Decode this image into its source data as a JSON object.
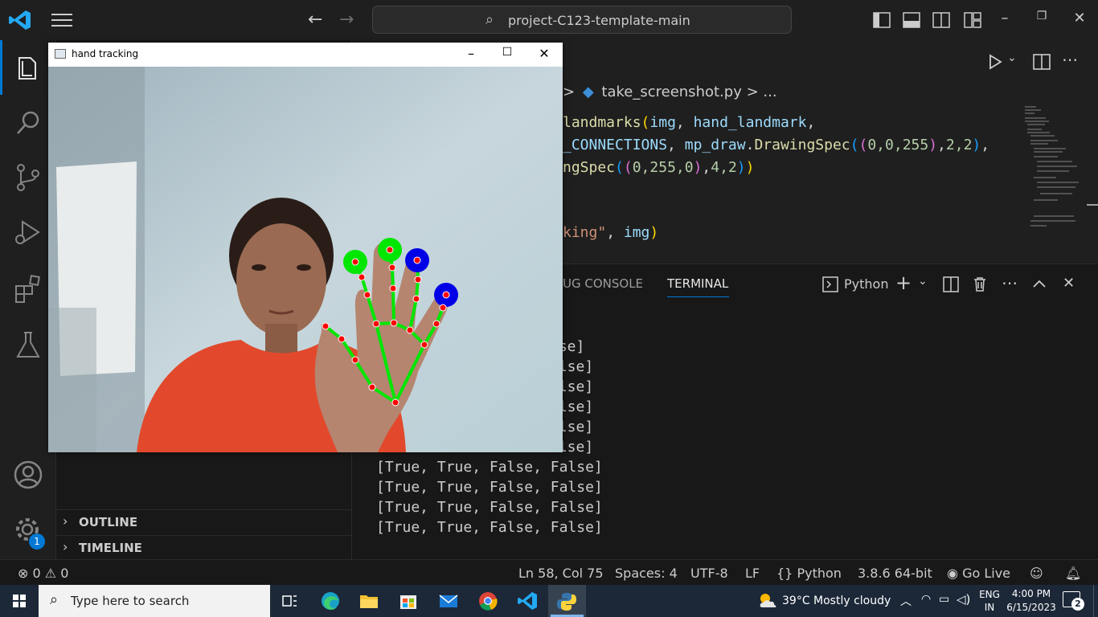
{
  "titlebar": {
    "search_text": "project-C123-template-main"
  },
  "activity": {
    "settings_badge": "1"
  },
  "sidebar": {
    "sections": [
      {
        "label": "OUTLINE"
      },
      {
        "label": "TIMELINE"
      }
    ]
  },
  "editor": {
    "breadcrumb_file": "take_screenshot.py",
    "breadcrumb_sep": ">",
    "breadcrumb_more": "...",
    "lines": [
      {
        "a": "landmarks",
        "b": "img",
        "c": "hand_landmark"
      },
      {
        "a": "_CONNECTIONS",
        "b": "mp_draw",
        "c": "DrawingSpec",
        "d": "0,0,255",
        "e": "2,2"
      },
      {
        "a": "ngSpec",
        "d": "0,255,0",
        "e": "4,2"
      },
      {
        "a": "king\"",
        "b": "img"
      }
    ]
  },
  "panel": {
    "tab_debug": "UG CONSOLE",
    "tab_terminal": "TERMINAL",
    "terminal_profile": "Python",
    "output": [
      "lse]",
      "alse]",
      "alse]",
      "alse]",
      "alse]",
      "alse]",
      "[True, True, False, False]",
      "[True, True, False, False]",
      "[True, True, False, False]",
      "[True, True, False, False]"
    ]
  },
  "statusbar": {
    "errors": "0",
    "warnings": "0",
    "position": "Ln 58, Col 75",
    "spaces": "Spaces: 4",
    "encoding": "UTF-8",
    "eol": "LF",
    "language": "Python",
    "interpreter": "3.8.6 64-bit",
    "golive": "Go Live"
  },
  "hand_window": {
    "title": "hand tracking"
  },
  "taskbar": {
    "search_placeholder": "Type here to search",
    "weather": "39°C  Mostly cloudy",
    "lang_1": "ENG",
    "lang_2": "IN",
    "time": "4:00 PM",
    "date": "6/15/2023",
    "notifications": "2"
  },
  "colors": {
    "accent": "#0078d4",
    "landmark_point": "#ff0000",
    "connection_line": "#00ff00",
    "fingertip_up": "#00ff00",
    "fingertip_down": "#0000ff"
  }
}
